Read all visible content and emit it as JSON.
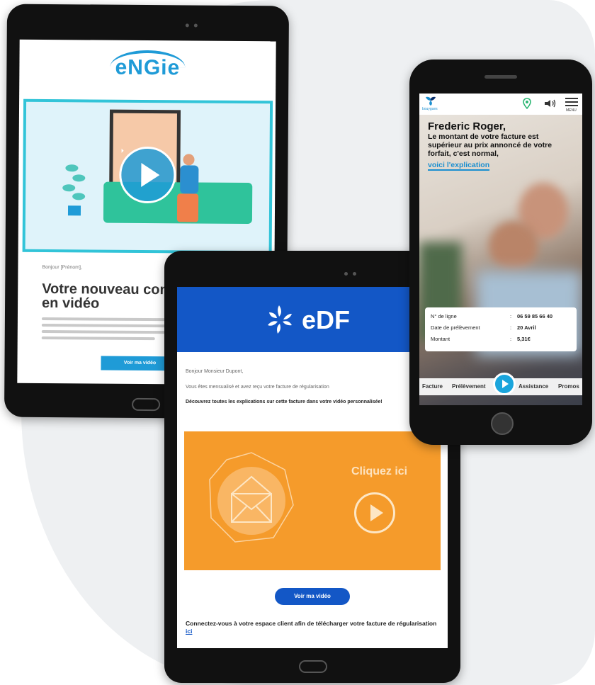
{
  "engie": {
    "logo": "eNGie",
    "greeting": "Bonjour [Prénom],",
    "title": "Votre nouveau contrat expliqué en vidéo",
    "button": "Voir ma vidéo"
  },
  "edf": {
    "logo": "eDF",
    "greeting": "Bonjour Monsieur Dupont,",
    "line1": "Vous êtes mensualisé et avez reçu votre facture de régularisation",
    "line2": "Découvrez toutes les explications sur cette facture dans votre vidéo personnalisée!",
    "cliquez": "Cliquez ici",
    "button": "Voir ma vidéo",
    "footer": "Connectez-vous à votre espace client afin de télécharger votre facture de régularisation",
    "footer_link": "ici"
  },
  "bouygues": {
    "brand": "bouygues",
    "menu": "MENU",
    "name": "Frederic Roger,",
    "message": "Le montant de votre facture est supérieur au prix annoncé de votre forfait, c'est normal,",
    "link": "voici l'explication",
    "rows": [
      {
        "label": "N° de ligne",
        "value": "06 59 85 66 40"
      },
      {
        "label": "Date de prélèvement",
        "value": "20 Avril"
      },
      {
        "label": "Montant",
        "value": "5,31€"
      }
    ],
    "tabs": [
      "Facture",
      "Prélèvement",
      "Assistance",
      "Promos"
    ]
  }
}
